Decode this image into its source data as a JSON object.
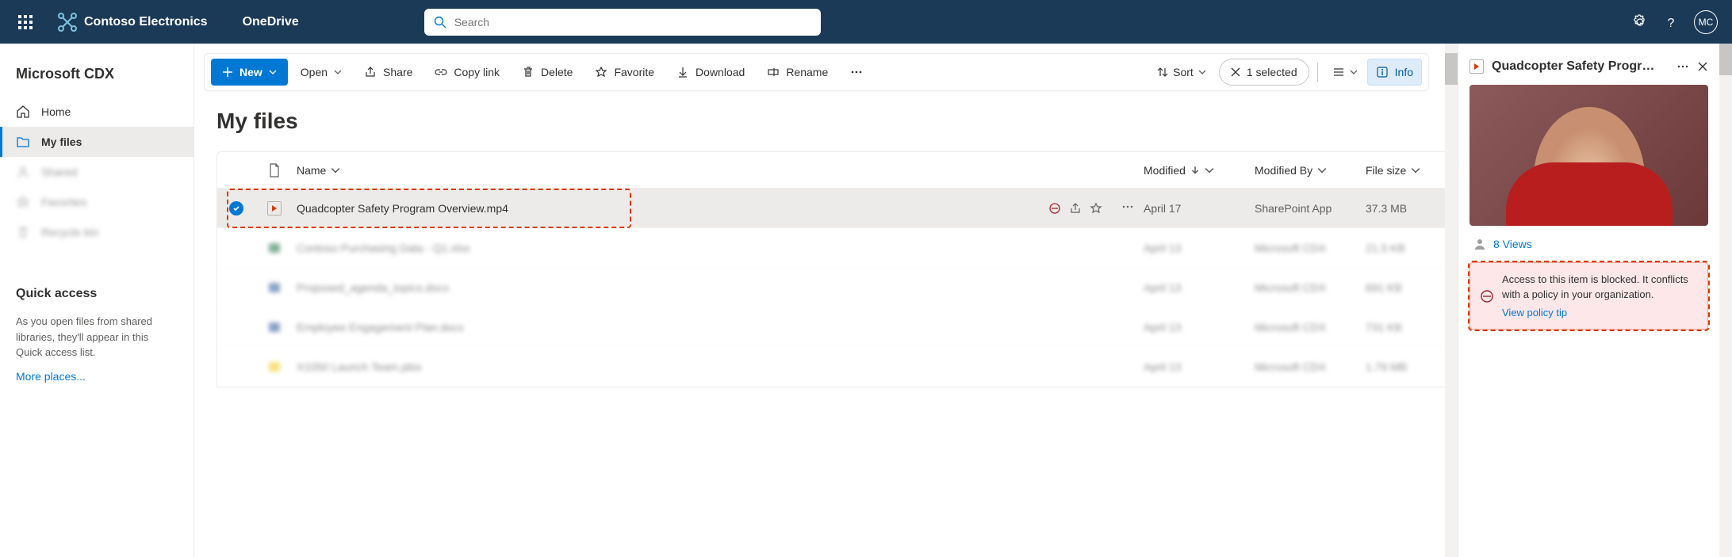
{
  "header": {
    "brand": "Contoso Electronics",
    "app": "OneDrive",
    "search_placeholder": "Search",
    "avatar_initials": "MC"
  },
  "sidebar": {
    "site_name": "Microsoft CDX",
    "items": [
      {
        "label": "Home",
        "icon": "home-icon"
      },
      {
        "label": "My files",
        "icon": "folder-icon"
      },
      {
        "label": "Shared",
        "icon": "person-icon"
      },
      {
        "label": "Favorites",
        "icon": "star-icon"
      },
      {
        "label": "Recycle bin",
        "icon": "trash-icon"
      }
    ],
    "quick_access": {
      "title": "Quick access",
      "description": "As you open files from shared libraries, they'll appear in this Quick access list.",
      "link_label": "More places..."
    }
  },
  "commands": {
    "new": "New",
    "open": "Open",
    "share": "Share",
    "copy_link": "Copy link",
    "delete": "Delete",
    "favorite": "Favorite",
    "download": "Download",
    "rename": "Rename",
    "sort": "Sort",
    "selected": "1 selected",
    "info": "Info"
  },
  "page": {
    "title": "My files",
    "columns": {
      "name": "Name",
      "modified": "Modified",
      "modified_by": "Modified By",
      "file_size": "File size"
    },
    "rows": [
      {
        "name": "Quadcopter Safety Program Overview.mp4",
        "modified": "April 17",
        "modified_by": "SharePoint App",
        "size": "37.3 MB",
        "selected": true,
        "blurred": false,
        "icon": "video"
      },
      {
        "name": "Contoso Purchasing Data - Q1.xlsx",
        "modified": "April 13",
        "modified_by": "Microsoft CDX",
        "size": "21.5 KB",
        "selected": false,
        "blurred": true,
        "icon": "xlsx"
      },
      {
        "name": "Proposed_agenda_topics.docx",
        "modified": "April 13",
        "modified_by": "Microsoft CDX",
        "size": "691 KB",
        "selected": false,
        "blurred": true,
        "icon": "docx"
      },
      {
        "name": "Employee Engagement Plan.docx",
        "modified": "April 13",
        "modified_by": "Microsoft CDX",
        "size": "731 KB",
        "selected": false,
        "blurred": true,
        "icon": "docx"
      },
      {
        "name": "X1050 Launch Team.pbix",
        "modified": "April 13",
        "modified_by": "Microsoft CDX",
        "size": "1.79 MB",
        "selected": false,
        "blurred": true,
        "icon": "pbix"
      }
    ]
  },
  "details": {
    "title": "Quadcopter Safety Progr…",
    "views": "8 Views",
    "alert_text": "Access to this item is blocked. It conflicts with a policy in your organization.",
    "alert_link": "View policy tip"
  }
}
